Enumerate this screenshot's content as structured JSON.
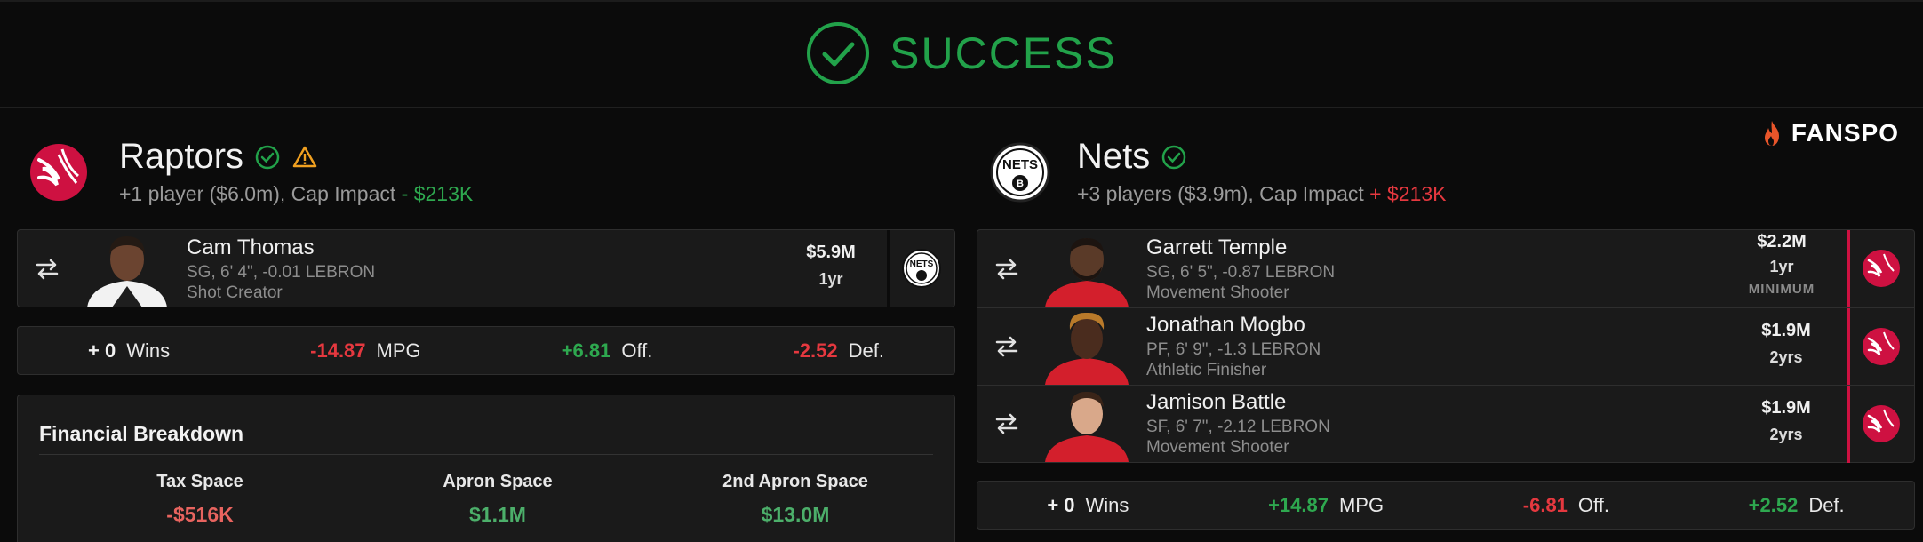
{
  "banner": {
    "status_text": "SUCCESS",
    "status_color": "#22a24a"
  },
  "brand": {
    "name": "FANSPO"
  },
  "left_team": {
    "name": "Raptors",
    "summary": "+1 player ($6.0m), Cap Impact",
    "cap_impact": "- $213K",
    "status_icons": [
      "check-circle-icon",
      "warning-icon"
    ],
    "players": [
      {
        "name": "Cam Thomas",
        "meta": "SG, 6' 4\", -0.01 LEBRON",
        "role": "Shot Creator",
        "salary": "$5.9M",
        "years": "1yr",
        "destination": "Nets"
      }
    ],
    "stats": [
      {
        "value": "+ 0",
        "label": "Wins",
        "tone": "white"
      },
      {
        "value": "-14.87",
        "label": "MPG",
        "tone": "red"
      },
      {
        "value": "+6.81",
        "label": "Off.",
        "tone": "green"
      },
      {
        "value": "-2.52",
        "label": "Def.",
        "tone": "red"
      }
    ],
    "financial": {
      "title": "Financial Breakdown",
      "columns": [
        {
          "label": "Tax Space",
          "value": "-$516K",
          "tone": "red"
        },
        {
          "label": "Apron Space",
          "value": "$1.1M",
          "tone": "green"
        },
        {
          "label": "2nd Apron Space",
          "value": "$13.0M",
          "tone": "green"
        }
      ]
    }
  },
  "right_team": {
    "name": "Nets",
    "summary": "+3 players ($3.9m), Cap Impact",
    "cap_impact": "+ $213K",
    "status_icons": [
      "check-circle-icon"
    ],
    "players": [
      {
        "name": "Garrett Temple",
        "meta": "SG, 6' 5\", -0.87 LEBRON",
        "role": "Movement Shooter",
        "salary": "$2.2M",
        "years": "1yr",
        "flag": "MINIMUM",
        "destination": "Raptors"
      },
      {
        "name": "Jonathan Mogbo",
        "meta": "PF, 6' 9\", -1.3 LEBRON",
        "role": "Athletic Finisher",
        "salary": "$1.9M",
        "years": "2yrs",
        "destination": "Raptors"
      },
      {
        "name": "Jamison Battle",
        "meta": "SF, 6' 7\", -2.12 LEBRON",
        "role": "Movement Shooter",
        "salary": "$1.9M",
        "years": "2yrs",
        "destination": "Raptors"
      }
    ],
    "stats": [
      {
        "value": "+ 0",
        "label": "Wins",
        "tone": "white"
      },
      {
        "value": "+14.87",
        "label": "MPG",
        "tone": "green"
      },
      {
        "value": "-6.81",
        "label": "Off.",
        "tone": "red"
      },
      {
        "value": "+2.52",
        "label": "Def.",
        "tone": "green"
      }
    ]
  },
  "colors": {
    "raptors_red": "#ce1141",
    "nets_black": "#000000",
    "success_green": "#22a24a",
    "negative_red": "#e5383f"
  }
}
